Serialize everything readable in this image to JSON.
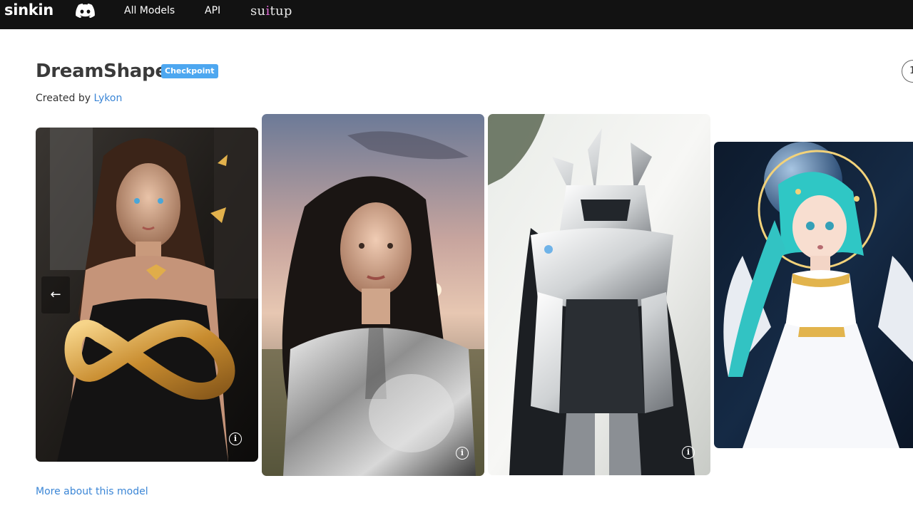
{
  "nav": {
    "brand": "sinkin",
    "links": [
      "All Models",
      "API"
    ],
    "partner_logo": {
      "before": "su",
      "tie": "i",
      "after": "tup"
    }
  },
  "model": {
    "title": "DreamShaper",
    "badge": "Checkpoint",
    "created_prefix": "Created by",
    "author": "Lykon",
    "right_button": "1"
  },
  "gallery": {
    "prev_arrow": "←",
    "info_glyph": "i",
    "images": [
      {
        "subject": "woman with butterflies and golden infinity symbol"
      },
      {
        "subject": "woman in silver armor at sunset"
      },
      {
        "subject": "white mecha robot"
      },
      {
        "subject": "anime angel girl with turquoise hair"
      }
    ]
  },
  "footer": {
    "more_link": "More about this model"
  },
  "colors": {
    "topbar": "#121212",
    "link": "#3b86d6",
    "badge": "#4da7f0",
    "title": "#3a3a3a"
  }
}
